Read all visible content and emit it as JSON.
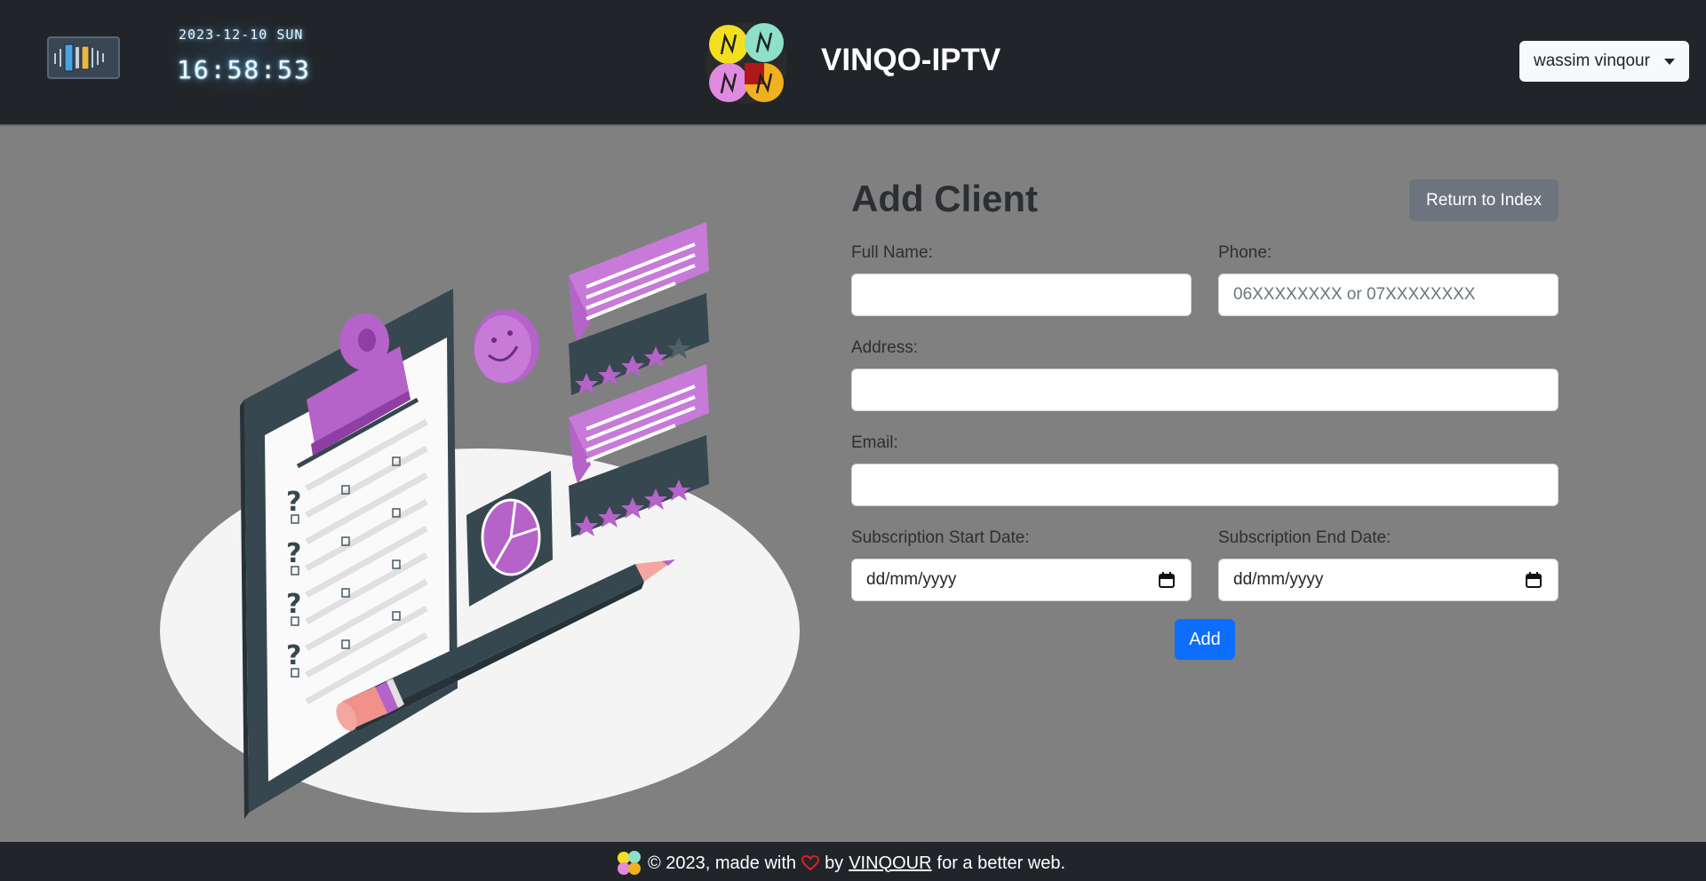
{
  "header": {
    "clock_date": "2023-12-10 SUN",
    "clock_time": "16:58:53",
    "brand_name": "VINQO-IPTV",
    "user_name": "wassim vinqour"
  },
  "form": {
    "title": "Add Client",
    "return_label": "Return to Index",
    "full_name_label": "Full Name:",
    "full_name_value": "",
    "phone_label": "Phone:",
    "phone_placeholder": "06XXXXXXXX or 07XXXXXXXX",
    "address_label": "Address:",
    "address_value": "",
    "email_label": "Email:",
    "email_value": "",
    "start_date_label": "Subscription Start Date:",
    "start_date_value": "dd/mm/yyyy",
    "end_date_label": "Subscription End Date:",
    "end_date_value": "dd/mm/yyyy",
    "add_label": "Add"
  },
  "footer": {
    "text_before": "© 2023, made with",
    "text_by": "by",
    "author_link": "VINQOUR",
    "text_after": "for a better web."
  },
  "colors": {
    "navbar": "#212529",
    "page_bg": "#808080",
    "primary": "#0d6efd",
    "secondary": "#6c757d",
    "illustration_accent": "#b562c9"
  }
}
